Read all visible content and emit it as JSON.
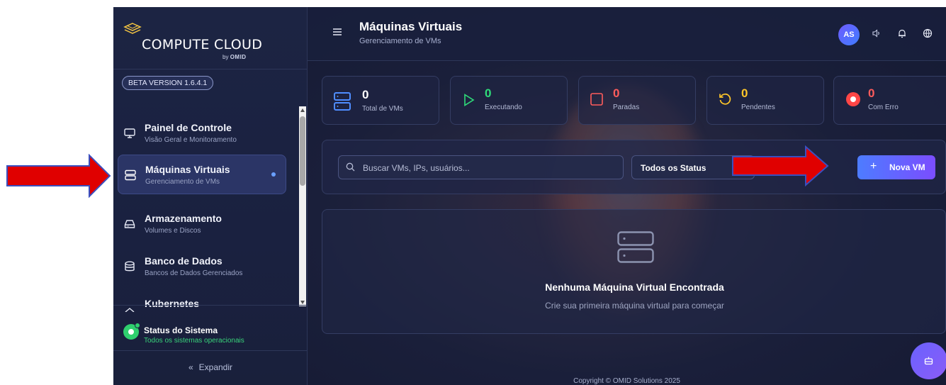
{
  "brand": {
    "title": "COMPUTE CLOUD",
    "by": "by",
    "by_company": "OMID",
    "beta": "BETA VERSION 1.6.4.1"
  },
  "sidebar": {
    "items": [
      {
        "title": "Painel de Controle",
        "sub": "Visão Geral e Monitoramento",
        "icon": "monitor-icon"
      },
      {
        "title": "Máquinas Virtuais",
        "sub": "Gerenciamento de VMs",
        "icon": "server-icon",
        "active": true
      },
      {
        "title": "Armazenamento",
        "sub": "Volumes e Discos",
        "icon": "hard-drive-icon"
      },
      {
        "title": "Banco de Dados",
        "sub": "Bancos de Dados Gerenciados",
        "icon": "database-icon"
      },
      {
        "title": "Kubernetes",
        "sub": "",
        "icon": "kubernetes-icon"
      }
    ],
    "status_title": "Status do Sistema",
    "status_sub": "Todos os sistemas operacionais",
    "expand_label": "Expandir"
  },
  "header": {
    "title": "Máquinas Virtuais",
    "subtitle": "Gerenciamento de VMs",
    "avatar": "AS"
  },
  "stats": [
    {
      "value": "0",
      "label": "Total de VMs",
      "color": "#ffffff",
      "icon": "server-icon"
    },
    {
      "value": "0",
      "label": "Executando",
      "color": "#2fdc7a",
      "icon": "play-icon"
    },
    {
      "value": "0",
      "label": "Paradas",
      "color": "#ff5c5c",
      "icon": "stop-icon"
    },
    {
      "value": "0",
      "label": "Pendentes",
      "color": "#ffc629",
      "icon": "refresh-icon"
    },
    {
      "value": "0",
      "label": "Com Erro",
      "color": "#ff5c5c",
      "icon": "error-icon"
    }
  ],
  "filters": {
    "search_placeholder": "Buscar VMs, IPs, usuários...",
    "status_value": "Todos os Status",
    "new_vm": "Nova VM"
  },
  "empty": {
    "title": "Nenhuma Máquina Virtual Encontrada",
    "subtitle": "Crie sua primeira máquina virtual para começar"
  },
  "footer": {
    "copyright": "Copyright © OMID Solutions 2025"
  }
}
